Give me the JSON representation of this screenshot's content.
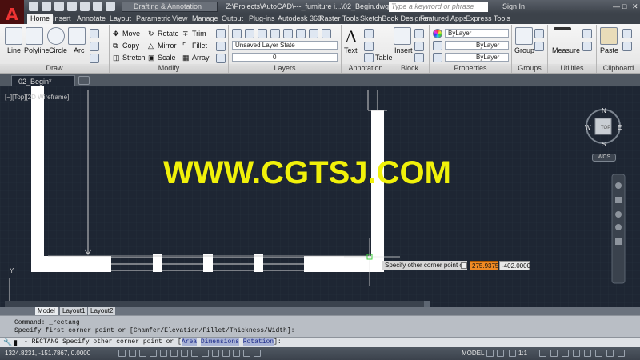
{
  "titlebar": {
    "workspace": "Drafting & Annotation",
    "file_path": "Z:\\Projects\\AutoCAD\\---_furniture i...\\02_Begin.dwg",
    "search_placeholder": "Type a keyword or phrase",
    "sign_in": "Sign In"
  },
  "menu": [
    "Home",
    "Insert",
    "Annotate",
    "Layout",
    "Parametric",
    "View",
    "Manage",
    "Output",
    "Plug-ins",
    "Autodesk 360",
    "Raster Tools",
    "SketchBook Designer",
    "Featured Apps",
    "Express Tools"
  ],
  "ribbon": {
    "draw": {
      "line": "Line",
      "polyline": "Polyline",
      "circle": "Circle",
      "arc": "Arc",
      "panel": "Draw"
    },
    "modify": {
      "move": "Move",
      "rotate": "Rotate",
      "trim": "Trim",
      "copy": "Copy",
      "mirror": "Mirror",
      "fillet": "Fillet",
      "stretch": "Stretch",
      "scale": "Scale",
      "array": "Array",
      "panel": "Modify"
    },
    "layers": {
      "layer_state": "Unsaved Layer State",
      "current_layer": "0",
      "panel": "Layers"
    },
    "annotation": {
      "text": "Text",
      "table": "Table",
      "panel": "Annotation"
    },
    "block": {
      "insert": "Insert",
      "panel": "Block"
    },
    "properties": {
      "color": "ByLayer",
      "linetype": "ByLayer",
      "lineweight": "ByLayer",
      "panel": "Properties"
    },
    "groups": {
      "group": "Group",
      "panel": "Groups"
    },
    "utilities": {
      "measure": "Measure",
      "panel": "Utilities"
    },
    "clipboard": {
      "paste": "Paste",
      "panel": "Clipboard"
    }
  },
  "doc_tab": "02_Begin*",
  "viewport_label": "[−][Top][2D Wireframe]",
  "viewcube": {
    "top": "TOP",
    "n": "N",
    "s": "S",
    "e": "E",
    "w": "W",
    "wcs": "WCS"
  },
  "watermark": "WWW.CGTSJ.COM",
  "dynamic_input": {
    "prompt": "Specify other corner point or",
    "x": "275.9375",
    "y": "-402.0000"
  },
  "ucs_y": "Y",
  "layout_tabs": [
    "Model",
    "Layout1",
    "Layout2"
  ],
  "command_history": [
    "Command: _rectang",
    "Specify first corner point or [Chamfer/Elevation/Fillet/Thickness/Width]:"
  ],
  "command_line": {
    "prefix": "- RECTANG Specify other corner point or [",
    "opt1": "Area",
    "opt2": "Dimensions",
    "opt3": "Rotation",
    "suffix": "]:"
  },
  "status": {
    "coords": "1324.8231, -151.7867, 0.0000",
    "model": "MODEL",
    "scale": "1:1"
  },
  "colors": {
    "canvas": "#1e2633",
    "wall": "#ffffff",
    "watermark": "#f1f10a",
    "dynamic_active": "#f08a24"
  }
}
